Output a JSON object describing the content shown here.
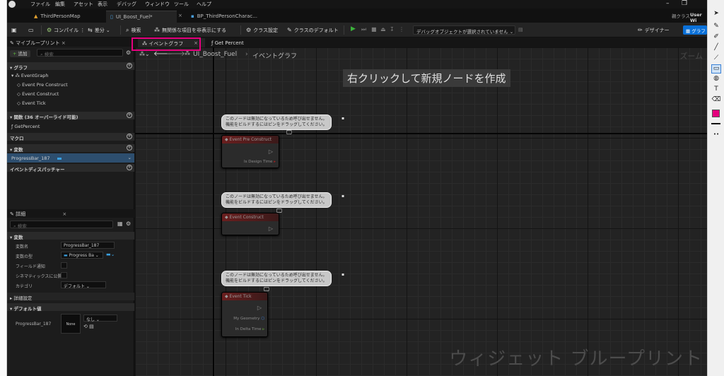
{
  "menubar": {
    "items": [
      "ファイル",
      "編集",
      "アセット",
      "表示",
      "デバッグ",
      "ウィンドウ",
      "ツール",
      "ヘルプ"
    ]
  },
  "tabs": [
    {
      "label": "ThirdPersonMap"
    },
    {
      "label": "UI_Boost_Fuel*"
    },
    {
      "label": "BP_ThirdPersonCharac..."
    }
  ],
  "parent_class": {
    "label": "親クラス",
    "value": "User Wi"
  },
  "toolbar": {
    "compile": "コンパイル",
    "diff": "差分",
    "search": "検索",
    "hide_unrelated": "無関係な項目を非表示にする",
    "class_settings": "クラス設定",
    "class_defaults": "クラスのデフォルト",
    "debug_select": "デバッグオブジェクトが選択されていません",
    "designer": "デザイナー",
    "graph": "グラフ"
  },
  "my_blueprint": {
    "title": "マイブループリント",
    "add": "追加",
    "search_placeholder": "検索",
    "sections": {
      "graph": "グラフ",
      "functions": "関数 (36 オーバーライド可能)",
      "macros": "マクロ",
      "variables": "変数",
      "dispatchers": "イベントディスパッチャー"
    },
    "graph_items": [
      "EventGraph",
      "Event Pre Construct",
      "Event Construct",
      "Event Tick"
    ],
    "function_items": [
      "GetPercent"
    ],
    "variable_items": [
      "ProgressBar_187"
    ]
  },
  "details": {
    "title": "詳細",
    "search_placeholder": "検索",
    "section_variable": "変数",
    "rows": [
      {
        "label": "変数名",
        "value": "ProgressBar_187"
      },
      {
        "label": "変数の型",
        "value": "Progress Ba"
      },
      {
        "label": "フィールド通知",
        "value": ""
      },
      {
        "label": "シネマティックスに公開",
        "value": ""
      },
      {
        "label": "カテゴリ",
        "value": "デフォルト"
      }
    ],
    "advanced": "詳細設定",
    "defaults_section": "デフォルト値",
    "default_var_label": "ProgressBar_187",
    "default_thumb": "None",
    "default_value": "なし"
  },
  "doc_tabs": {
    "event_graph": "イベントグラフ",
    "get_percent": "Get Percent"
  },
  "breadcrumb": {
    "asset": "UI_Boost_Fuel",
    "graph": "イベントグラフ"
  },
  "graph": {
    "hint": "右クリックして新規ノードを作成",
    "zoom": "ズーム",
    "watermark": "ウィジェット ブループリント",
    "comment_line1": "このノードは無効になっているため呼び出せません。",
    "comment_line2": "機能をビルドするにはピンをドラッグしてください。",
    "nodes": [
      {
        "title": "Event Pre Construct",
        "pins": [
          "Is Design Time"
        ]
      },
      {
        "title": "Event Construct",
        "pins": []
      },
      {
        "title": "Event Tick",
        "pins": [
          "My Geometry",
          "In Delta Time"
        ]
      }
    ]
  },
  "colors": {
    "accent": "#e6007e",
    "selected": "#2d4e6e",
    "play": "#3bb33b",
    "blue_button": "#0a70d8"
  }
}
